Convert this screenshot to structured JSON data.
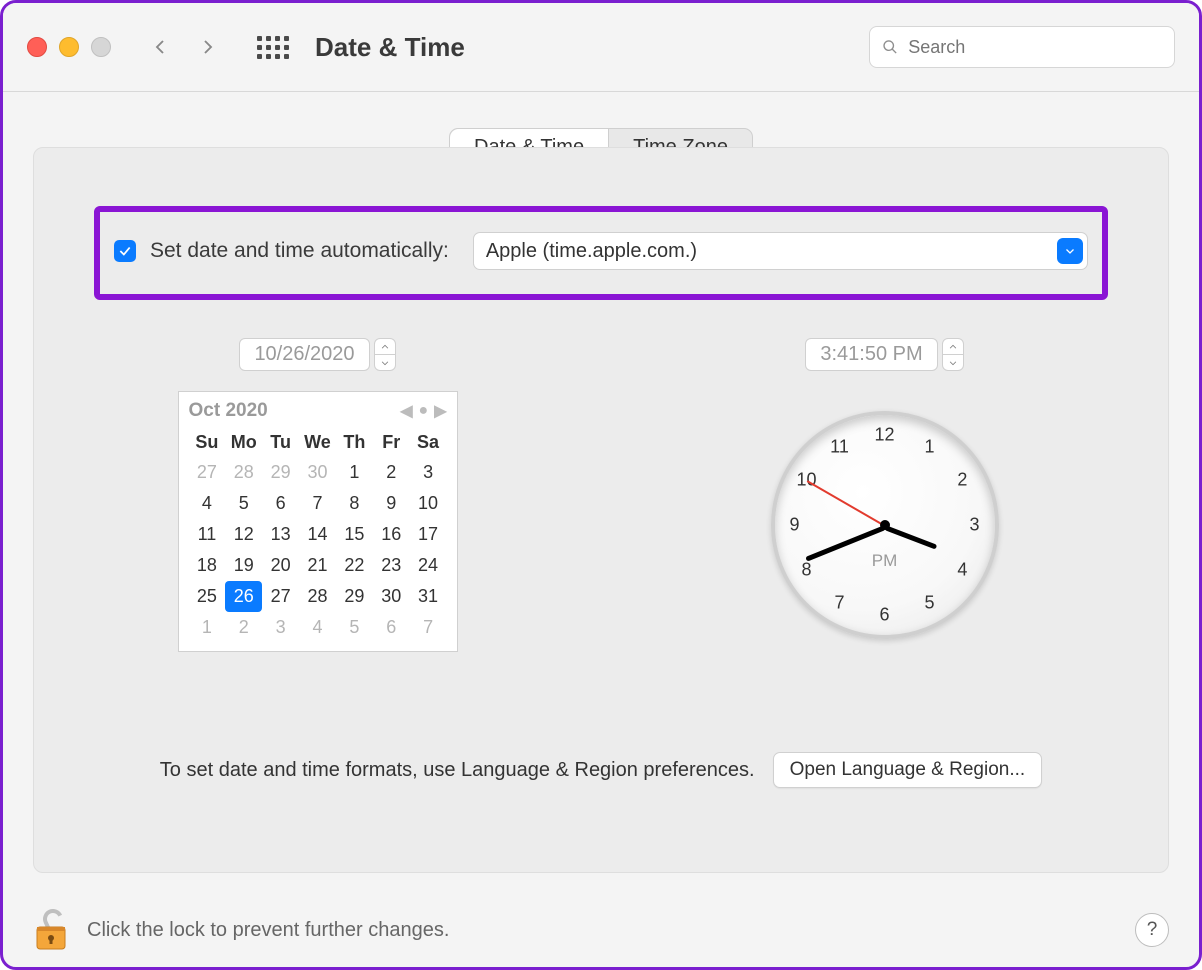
{
  "window": {
    "title": "Date & Time"
  },
  "search": {
    "placeholder": "Search"
  },
  "tabs": {
    "datetime": "Date & Time",
    "timezone": "Time Zone"
  },
  "auto": {
    "label": "Set date and time automatically:",
    "server": "Apple (time.apple.com.)"
  },
  "date": {
    "value": "10/26/2020"
  },
  "time": {
    "value": "3:41:50 PM"
  },
  "calendar": {
    "month_label": "Oct 2020",
    "dow": [
      "Su",
      "Mo",
      "Tu",
      "We",
      "Th",
      "Fr",
      "Sa"
    ],
    "leading": [
      "27",
      "28",
      "29",
      "30"
    ],
    "month_days": [
      "1",
      "2",
      "3",
      "4",
      "5",
      "6",
      "7",
      "8",
      "9",
      "10",
      "11",
      "12",
      "13",
      "14",
      "15",
      "16",
      "17",
      "18",
      "19",
      "20",
      "21",
      "22",
      "23",
      "24",
      "25",
      "26",
      "27",
      "28",
      "29",
      "30",
      "31"
    ],
    "trailing": [
      "1",
      "2",
      "3",
      "4",
      "5",
      "6",
      "7"
    ],
    "selected": "26"
  },
  "clock": {
    "numbers": [
      "12",
      "1",
      "2",
      "3",
      "4",
      "5",
      "6",
      "7",
      "8",
      "9",
      "10",
      "11"
    ],
    "ampm": "PM"
  },
  "formats_hint": "To set date and time formats, use Language & Region preferences.",
  "open_lang_btn": "Open Language & Region...",
  "lock_hint": "Click the lock to prevent further changes.",
  "help": "?"
}
